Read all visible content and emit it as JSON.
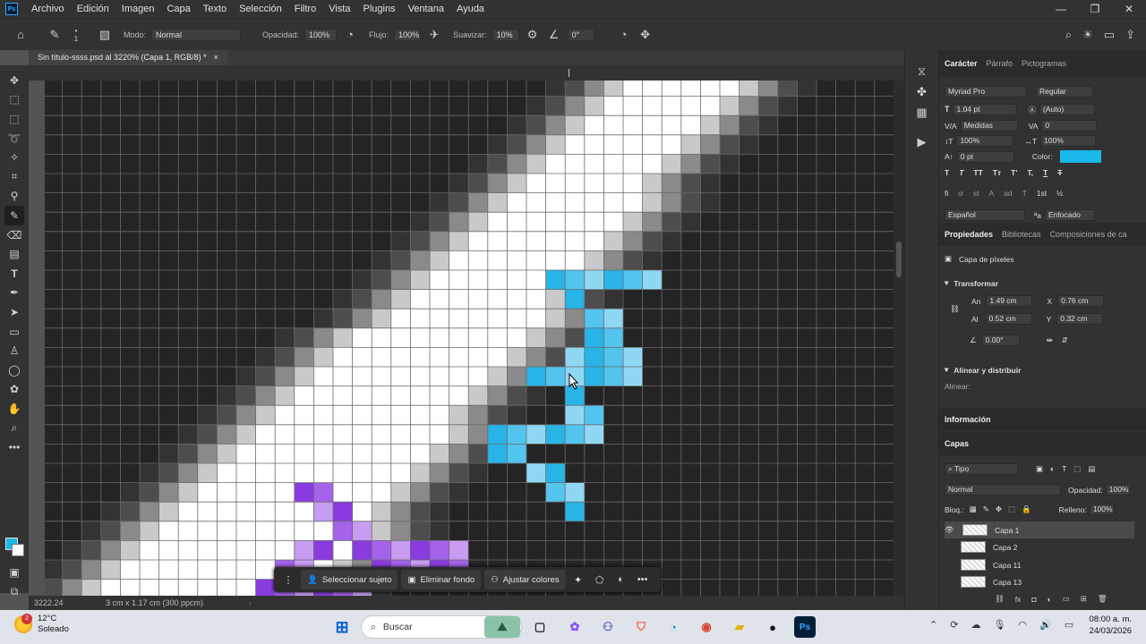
{
  "app": {
    "badge": "Ps"
  },
  "menu": {
    "items": [
      "Archivo",
      "Edición",
      "Imagen",
      "Capa",
      "Texto",
      "Selección",
      "Filtro",
      "Vista",
      "Plugins",
      "Ventana",
      "Ayuda"
    ]
  },
  "options": {
    "mode_label": "Modo:",
    "mode_value": "Normal",
    "opacity_label": "Opacidad:",
    "opacity_value": "100%",
    "flow_label": "Flujo:",
    "flow_value": "100%",
    "smooth_label": "Suavizar:",
    "smooth_value": "10%",
    "angle_value": "0°",
    "brush_size": "1"
  },
  "document": {
    "tab_title": "Sin título-ssss.psd al 3220% (Capa 1, RGB/8) *",
    "close": "×"
  },
  "status": {
    "zoom": "3222.24",
    "doc_info": "3 cm x 1.17 cm (300 ppcm)"
  },
  "floatbar": {
    "select_subject": "Seleccionar sujeto",
    "remove_bg": "Eliminar fondo",
    "adjust_colors": "Ajustar colores",
    "more": "•••"
  },
  "colors": {
    "foreground": "#1ab8e8",
    "accent": "#31a8ff"
  },
  "character": {
    "tabs": [
      "Carácter",
      "Párrafo",
      "Pictogramas"
    ],
    "font_family": "Myriad Pro",
    "font_style": "Regular",
    "size": "1.04 pt",
    "leading": "(Auto)",
    "kerning": "Medidas",
    "tracking": "0",
    "vscale": "100%",
    "hscale": "100%",
    "baseline": "0 pt",
    "color_label": "Color:",
    "language": "Español",
    "antialias": "Enfocado",
    "style_buttons": [
      "T",
      "T",
      "TT",
      "Tт",
      "T'",
      "T,",
      "T",
      "T"
    ],
    "ot_buttons": [
      "fi",
      "ơ",
      "st",
      "A",
      "ad",
      "T",
      "1st",
      "½"
    ]
  },
  "properties": {
    "tabs": [
      "Propiedades",
      "Bibliotecas",
      "Composiciones de ca"
    ],
    "layer_type": "Capa de píxeles",
    "transform_title": "Transformar",
    "w_label": "An",
    "w_value": "1.49 cm",
    "x_label": "X",
    "x_value": "0.76 cm",
    "h_label": "Al",
    "h_value": "0.52 cm",
    "y_label": "Y",
    "y_value": "0.32 cm",
    "angle_value": "0.00°",
    "align_title": "Alinear y distribuir",
    "align_label": "Alinear:"
  },
  "info": {
    "title": "Información"
  },
  "layers": {
    "title": "Capas",
    "filter": "Tipo",
    "blend_mode": "Normal",
    "opacity_label": "Opacidad:",
    "opacity_value": "100%",
    "lock_label": "Bloq.:",
    "fill_label": "Relleno:",
    "fill_value": "100%",
    "items": [
      "Capa 1",
      "Capa 2",
      "Capa 11",
      "Capa 13"
    ]
  },
  "taskbar": {
    "temp": "12°C",
    "weather": "Soleado",
    "weather_badge": "2",
    "search_placeholder": "Buscar",
    "time": "08:00 a. m.",
    "date": "24/03/2026"
  }
}
